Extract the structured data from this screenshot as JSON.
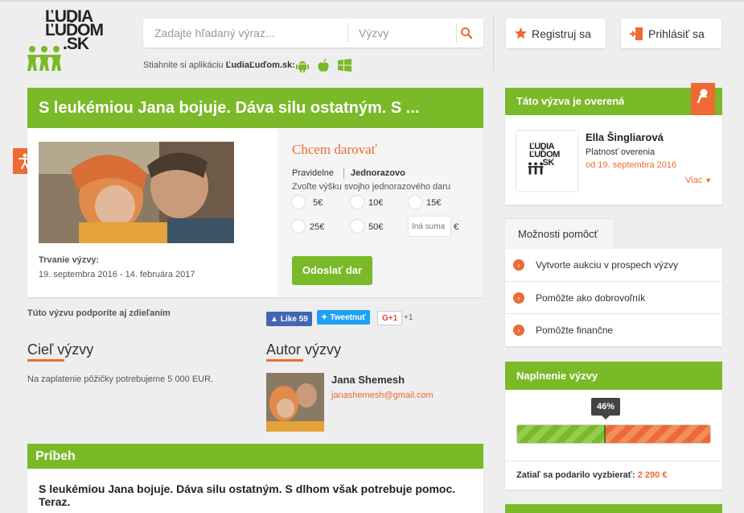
{
  "header": {
    "logo_text": [
      "ĽUDIA",
      "ĽUĎOM",
      ".SK"
    ],
    "search_placeholder": "Zadajte hľadaný výraz...",
    "search_select": "Výzvy",
    "app_prefix": "Stiahnite si aplikáciu",
    "app_name": "ĽudiaĽuďom.sk:",
    "register": "Registruj sa",
    "login": "Prihlásiť sa"
  },
  "challenge": {
    "title": "S leukémiou Jana bojuje. Dáva silu ostatným. S ...",
    "duration_label": "Trvanie výzvy:",
    "duration_value": "19. septembra 2016 - 14. februára 2017"
  },
  "donate": {
    "heading": "Chcem darovať",
    "option_regular": "Pravidelne",
    "option_once": "Jednorazovo",
    "instruction": "Zvoľte výšku svojho jednorazového daru",
    "amounts": [
      "5€",
      "10€",
      "15€",
      "25€",
      "50€"
    ],
    "custom_placeholder": "Iná suma",
    "currency": "€",
    "submit": "Odoslať dar"
  },
  "share": {
    "text": "Túto výzvu podporíte aj zdieľaním",
    "fb_label": "Like",
    "fb_count": "59",
    "tw_label": "Tweetnuť",
    "gplus_label": "G+1",
    "gplus_count": "+1"
  },
  "goal": {
    "heading": "Cieľ výzvy",
    "text": "Na zaplatenie pôžičky potrebujeme 5 000 EUR."
  },
  "author": {
    "heading": "Autor výzvy",
    "name": "Jana Shemesh",
    "email": "janashemesh@gmail.com"
  },
  "story": {
    "heading": "Príbeh",
    "lead": "S leukémiou Jana bojuje. Dáva silu ostatným. S dlhom však potrebuje pomoc. Teraz."
  },
  "verified": {
    "heading": "Táto výzva je overená",
    "name": "Ella Šingliarová",
    "validity_label": "Platnosť overenia",
    "validity_date": "od 19. septembra 2016",
    "more": "Viac"
  },
  "help": {
    "tab": "Možnosti pomôcť",
    "items": [
      "Vytvorte aukciu v prospech výzvy",
      "Pomôžte ako dobrovoľník",
      "Pomôžte finančne"
    ]
  },
  "progress": {
    "heading": "Naplnenie výzvy",
    "percent_label": "46%",
    "percent": 46,
    "raised_label": "Zatiaľ sa podarilo vyzbierať:",
    "raised_value": "2 290 €"
  },
  "colors": {
    "green": "#7ab928",
    "orange": "#ee6a34"
  },
  "icons": [
    "search-icon",
    "star-icon",
    "login-door-icon",
    "android-icon",
    "apple-icon",
    "windows-icon",
    "accessibility-icon",
    "pin-icon",
    "chevron-right-icon",
    "chevron-down-icon"
  ]
}
